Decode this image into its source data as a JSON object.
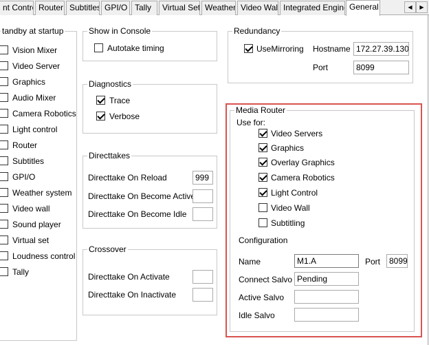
{
  "tabs": [
    "nt Control",
    "Router",
    "Subtitles",
    "GPI/O",
    "Tally",
    "Virtual Set",
    "Weather",
    "Video Wall",
    "Integrated Engine",
    "General"
  ],
  "active_tab": "General",
  "scroll_left_glyph": "◀",
  "scroll_right_glyph": "▶",
  "standby": {
    "title": "tandby at startup",
    "items": [
      {
        "label": "Vision Mixer",
        "checked": false
      },
      {
        "label": "Video Server",
        "checked": false
      },
      {
        "label": "Graphics",
        "checked": false
      },
      {
        "label": "Audio Mixer",
        "checked": false
      },
      {
        "label": "Camera Robotics",
        "checked": false
      },
      {
        "label": "Light control",
        "checked": false
      },
      {
        "label": "Router",
        "checked": false
      },
      {
        "label": "Subtitles",
        "checked": false
      },
      {
        "label": "GPI/O",
        "checked": false
      },
      {
        "label": "Weather system",
        "checked": false
      },
      {
        "label": "Video wall",
        "checked": false
      },
      {
        "label": "Sound player",
        "checked": false
      },
      {
        "label": "Virtual set",
        "checked": false
      },
      {
        "label": "Loudness control",
        "checked": false
      },
      {
        "label": "Tally",
        "checked": false
      }
    ]
  },
  "console": {
    "title": "Show in Console",
    "autotake_label": "Autotake timing",
    "autotake_checked": false
  },
  "diagnostics": {
    "title": "Diagnostics",
    "trace_label": "Trace",
    "trace_checked": true,
    "verbose_label": "Verbose",
    "verbose_checked": true
  },
  "directtakes": {
    "title": "Directtakes",
    "on_reload_label": "Directtake On Reload",
    "on_reload_value": "999",
    "on_become_active_label": "Directtake On Become Active",
    "on_become_active_value": "",
    "on_become_idle_label": "Directtake On Become Idle",
    "on_become_idle_value": ""
  },
  "crossover": {
    "title": "Crossover",
    "on_activate_label": "Directtake On Activate",
    "on_activate_value": "",
    "on_inactivate_label": "Directtake On Inactivate",
    "on_inactivate_value": ""
  },
  "redundancy": {
    "title": "Redundancy",
    "use_mirroring_label": "UseMirroring",
    "use_mirroring_checked": true,
    "hostname_label": "Hostname",
    "hostname_value": "172.27.39.130",
    "port_label": "Port",
    "port_value": "8099"
  },
  "media_router": {
    "title": "Media Router",
    "use_for_label": "Use for:",
    "items": [
      {
        "label": "Video Servers",
        "checked": true
      },
      {
        "label": "Graphics",
        "checked": true
      },
      {
        "label": "Overlay Graphics",
        "checked": true
      },
      {
        "label": "Camera Robotics",
        "checked": true
      },
      {
        "label": "Light Control",
        "checked": true
      },
      {
        "label": "Video Wall",
        "checked": false
      },
      {
        "label": "Subtitling",
        "checked": false
      }
    ],
    "configuration_label": "Configuration",
    "name_label": "Name",
    "name_value": "M1.A",
    "port_label": "Port",
    "port_value": "8099",
    "connect_salvo_label": "Connect Salvo",
    "connect_salvo_value": "Pending",
    "active_salvo_label": "Active Salvo",
    "active_salvo_value": "",
    "idle_salvo_label": "Idle Salvo",
    "idle_salvo_value": ""
  }
}
